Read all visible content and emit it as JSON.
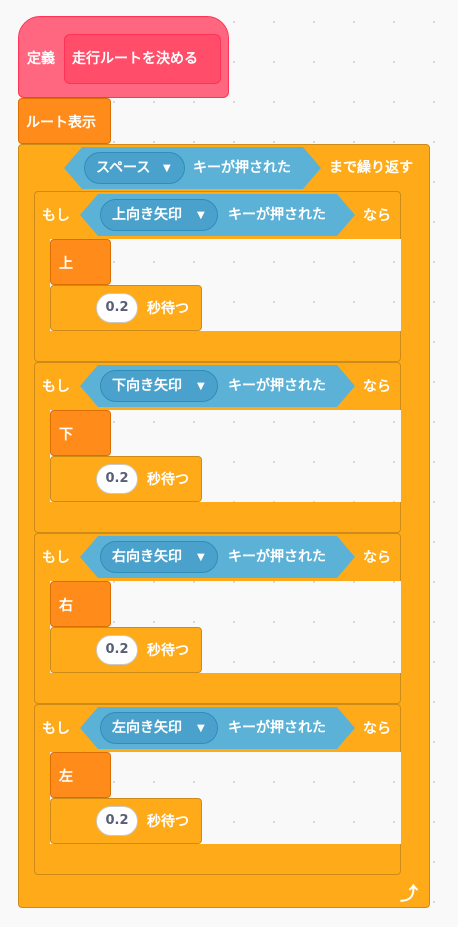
{
  "define": {
    "label": "定義",
    "name": "走行ルートを決める"
  },
  "route_display": "ルート表示",
  "loop": {
    "key_option": "スペース",
    "key_pressed": "キーが押された",
    "suffix": "まで繰り返す",
    "end_icon": "loop-arrow-icon"
  },
  "if_blocks": [
    {
      "if_label": "もし",
      "key_option": "上向き矢印",
      "key_pressed": "キーが押された",
      "then_label": "なら",
      "action": "上",
      "wait_value": "0.2",
      "wait_label": "秒待つ"
    },
    {
      "if_label": "もし",
      "key_option": "下向き矢印",
      "key_pressed": "キーが押された",
      "then_label": "なら",
      "action": "下",
      "wait_value": "0.2",
      "wait_label": "秒待つ"
    },
    {
      "if_label": "もし",
      "key_option": "右向き矢印",
      "key_pressed": "キーが押された",
      "then_label": "なら",
      "action": "右",
      "wait_value": "0.2",
      "wait_label": "秒待つ"
    },
    {
      "if_label": "もし",
      "key_option": "左向き矢印",
      "key_pressed": "キーが押された",
      "then_label": "なら",
      "action": "左",
      "wait_value": "0.2",
      "wait_label": "秒待つ"
    }
  ],
  "colors": {
    "control": "#ffab19",
    "control_border": "#cf8b17",
    "custom": "#ff8c1a",
    "define": "#ff6680",
    "sensing": "#5cb1d6",
    "sensing_menu": "#4aa2cc"
  }
}
